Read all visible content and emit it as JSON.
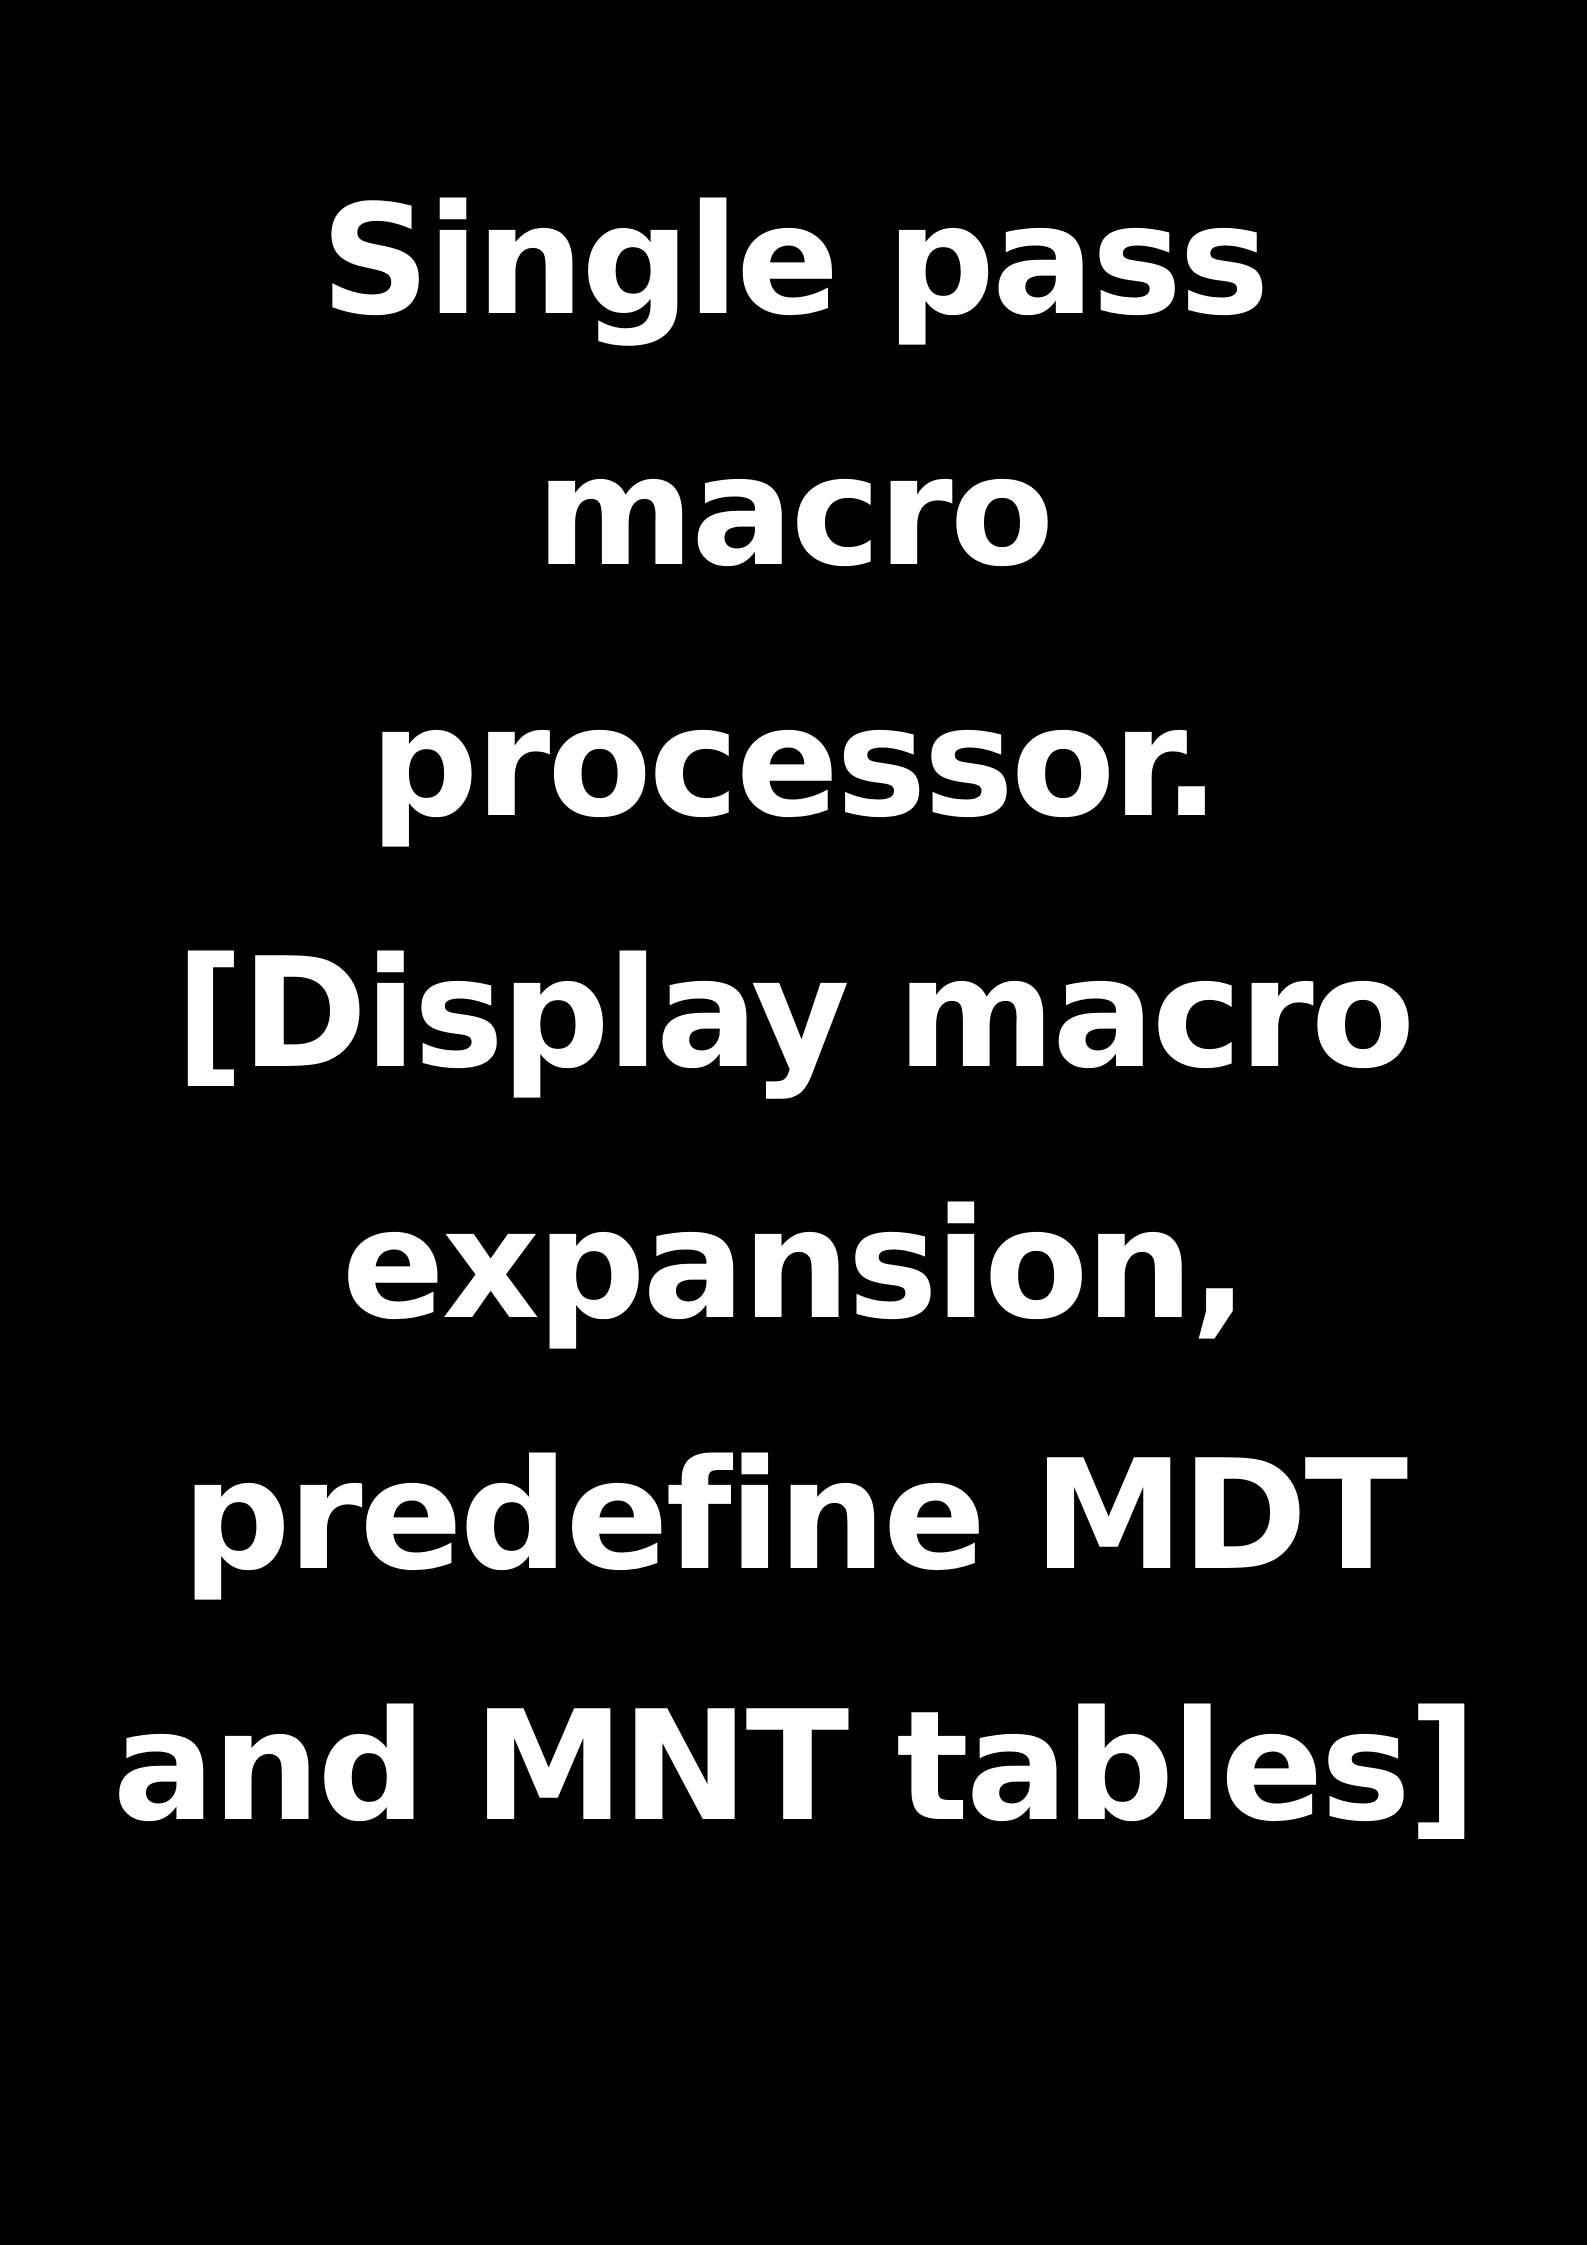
{
  "page": {
    "background_color": "#000000",
    "text_color": "#ffffff"
  },
  "title": {
    "lines": [
      "Single pass",
      "macro",
      "processor.",
      "[Display macro",
      "expansion,",
      "predefine MDT",
      "and MNT tables]"
    ]
  }
}
